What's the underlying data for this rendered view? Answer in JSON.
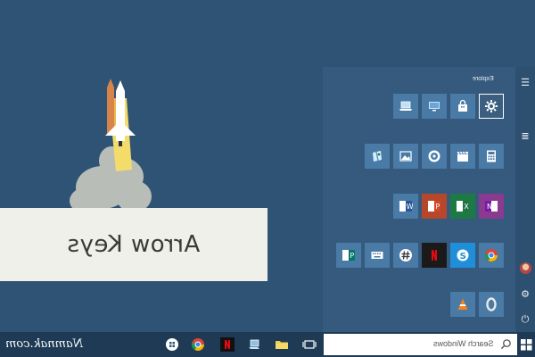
{
  "banner": {
    "title": "Arrow Keys"
  },
  "start_menu": {
    "group_label": "Explore",
    "rail": [
      {
        "name": "hamburger-icon",
        "glyph": "☰"
      },
      {
        "name": "all-apps-icon",
        "glyph": "≣"
      },
      {
        "name": "user-avatar",
        "glyph": ""
      },
      {
        "name": "settings-icon",
        "glyph": "⚙"
      },
      {
        "name": "power-icon",
        "glyph": "⏻"
      }
    ],
    "tiles": [
      {
        "name": "settings-tile",
        "icon": "gear-icon",
        "bg": "#3c5f80",
        "border": true
      },
      {
        "name": "store-tile",
        "icon": "shopping-bag-icon",
        "bg": "#4a7aa6"
      },
      {
        "name": "remote-tile",
        "icon": "monitor-icon",
        "bg": "#4a7aa6"
      },
      {
        "name": "laptop-tile",
        "icon": "laptop-icon",
        "bg": "#4a7aa6"
      },
      {
        "name": "calculator-tile",
        "icon": "calculator-icon",
        "bg": "#4a7aa6"
      },
      {
        "name": "movies-tile",
        "icon": "clapperboard-icon",
        "bg": "#4a7aa6"
      },
      {
        "name": "groove-tile",
        "icon": "disc-icon",
        "bg": "#4a7aa6"
      },
      {
        "name": "photos-tile",
        "icon": "image-icon",
        "bg": "#4a7aa6"
      },
      {
        "name": "maps-tile",
        "icon": "map-icon",
        "bg": "#4a7aa6"
      },
      {
        "name": "onenote-tile",
        "icon": "onenote-icon",
        "bg": "#8a3b8f"
      },
      {
        "name": "excel-tile",
        "icon": "excel-icon",
        "bg": "#1e7a45"
      },
      {
        "name": "powerpoint-tile",
        "icon": "powerpoint-icon",
        "bg": "#b7472a"
      },
      {
        "name": "word-tile",
        "icon": "word-icon",
        "bg": "#4a7aa6"
      },
      {
        "name": "chrome-tile",
        "icon": "chrome-icon",
        "bg": "#4a7aa6"
      },
      {
        "name": "skype-tile",
        "icon": "skype-icon",
        "bg": "#1e8fd8"
      },
      {
        "name": "netflix-tile",
        "icon": "netflix-icon",
        "bg": "#1a1a1a"
      },
      {
        "name": "slack-tile",
        "icon": "hashtag-icon",
        "bg": "#4a7aa6"
      },
      {
        "name": "keyboard-tile",
        "icon": "keyboard-icon",
        "bg": "#4a7aa6"
      },
      {
        "name": "publisher-tile",
        "icon": "publisher-icon",
        "bg": "#4a7aa6"
      },
      {
        "name": "opera-tile",
        "icon": "ring-icon",
        "bg": "#4a7aa6"
      },
      {
        "name": "vlc-tile",
        "icon": "cone-icon",
        "bg": "#4a7aa6"
      }
    ]
  },
  "taskbar": {
    "watermark": "Namnak.com",
    "search_placeholder": "Search Windows",
    "icons": [
      {
        "name": "task-view-icon"
      },
      {
        "name": "file-explorer-icon"
      },
      {
        "name": "edge-icon"
      },
      {
        "name": "netflix-icon"
      },
      {
        "name": "chrome-icon"
      },
      {
        "name": "windows-store-icon"
      }
    ]
  },
  "colors": {
    "desktop": "#2f5374",
    "start_menu": "#355a7d",
    "taskbar": "#1e3a55",
    "tile_blue": "#4a7aa6"
  }
}
